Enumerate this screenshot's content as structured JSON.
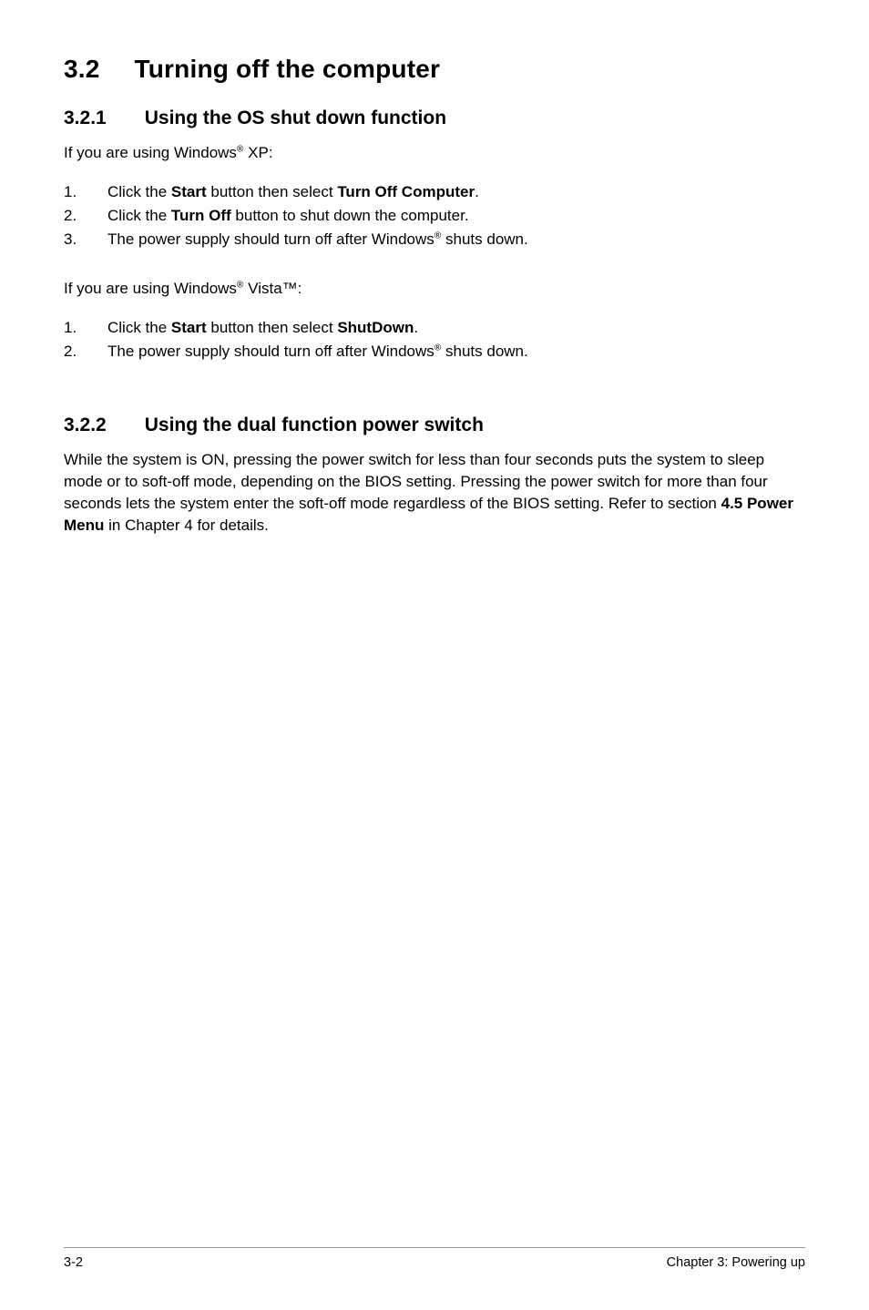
{
  "section": {
    "number": "3.2",
    "title": "Turning off the computer"
  },
  "sub1": {
    "number": "3.2.1",
    "title": "Using the OS shut down function",
    "intro_xp_pre": "If you are using Windows",
    "intro_xp_post": " XP:",
    "steps_xp": [
      {
        "num": "1.",
        "pre": "Click the ",
        "b1": "Start",
        "mid": " button then select ",
        "b2": "Turn Off Computer",
        "post": "."
      },
      {
        "num": "2.",
        "pre": "Click the ",
        "b1": "Turn Off",
        "mid": " button to shut down the computer.",
        "b2": "",
        "post": ""
      },
      {
        "num": "3.",
        "pre": "The power supply should turn off after Windows",
        "sup": "®",
        "post": " shuts down."
      }
    ],
    "intro_vista_pre": "If you are using Windows",
    "intro_vista_post": " Vista™:",
    "steps_vista": [
      {
        "num": "1.",
        "pre": "Click the ",
        "b1": "Start",
        "mid": " button then select ",
        "b2": "ShutDown",
        "post": "."
      },
      {
        "num": "2.",
        "pre": "The power supply should turn off after Windows",
        "sup": "®",
        "post": " shuts down."
      }
    ]
  },
  "sub2": {
    "number": "3.2.2",
    "title": "Using the dual function power switch",
    "para_pre": "While the system is ON, pressing the power switch for less than four seconds puts the system to sleep mode or to soft-off mode, depending on the BIOS setting. Pressing the power switch for more than four seconds lets the system enter the soft-off mode regardless of the BIOS setting. Refer to section ",
    "para_bold": "4.5 Power Menu",
    "para_post": " in Chapter 4 for details."
  },
  "footer": {
    "left": "3-2",
    "right": "Chapter 3: Powering up"
  }
}
